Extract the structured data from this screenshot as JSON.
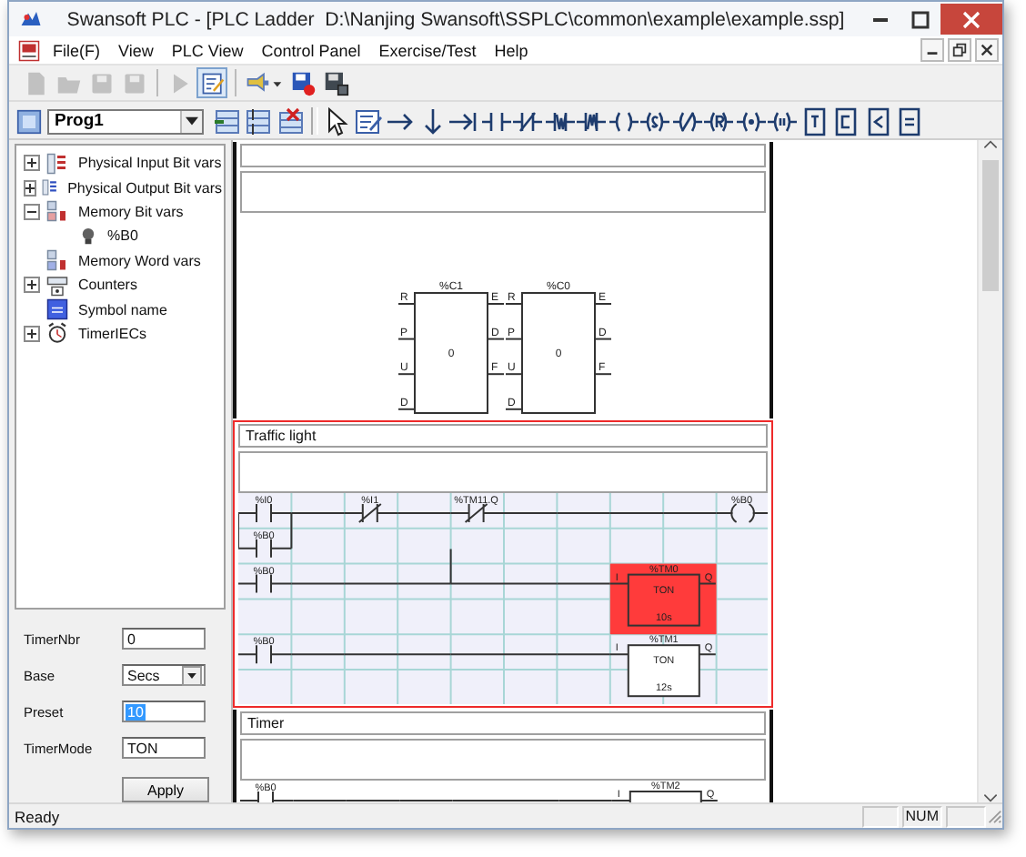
{
  "window": {
    "title": "Swansoft PLC - [PLC Ladder  D:\\Nanjing Swansoft\\SSPLC\\common\\example\\example.ssp]"
  },
  "menu": [
    "File(F)",
    "View",
    "PLC View",
    "Control Panel",
    "Exercise/Test",
    "Help"
  ],
  "toolbar": [
    {
      "kind": "page",
      "disabled": true,
      "selected": false
    },
    {
      "kind": "folder",
      "disabled": true,
      "selected": false
    },
    {
      "kind": "disk",
      "disabled": true,
      "selected": false
    },
    {
      "kind": "disk",
      "disabled": true,
      "selected": false
    },
    {
      "kind": "separator"
    },
    {
      "kind": "play",
      "disabled": true,
      "selected": false
    },
    {
      "kind": "edit",
      "disabled": false,
      "selected": true
    },
    {
      "kind": "separator"
    },
    {
      "kind": "connect",
      "disabled": false,
      "selected": false
    },
    {
      "kind": "disk_red",
      "disabled": false,
      "selected": false
    },
    {
      "kind": "disk_dark",
      "disabled": false,
      "selected": false
    }
  ],
  "program": {
    "value": "Prog1"
  },
  "tools": [
    {
      "kind": "rows_add"
    },
    {
      "kind": "rows_insert"
    },
    {
      "kind": "rows_delete"
    },
    {
      "kind": "separator"
    },
    {
      "kind": "pointer"
    },
    {
      "kind": "properties"
    },
    {
      "kind": "wire_h"
    },
    {
      "kind": "wire_v"
    },
    {
      "kind": "wire_end"
    },
    {
      "kind": "contact_no"
    },
    {
      "kind": "contact_nc"
    },
    {
      "kind": "contact_p"
    },
    {
      "kind": "contact_n"
    },
    {
      "kind": "coil"
    },
    {
      "kind": "coil_s"
    },
    {
      "kind": "coil_slash"
    },
    {
      "kind": "coil_r"
    },
    {
      "kind": "coil_dot"
    },
    {
      "kind": "coil_open"
    },
    {
      "kind": "box_t"
    },
    {
      "kind": "box_c"
    },
    {
      "kind": "box_lt"
    },
    {
      "kind": "box_eq"
    }
  ],
  "tree": [
    {
      "label": "Physical Input Bit vars",
      "kind": "input_bits",
      "expanded": false
    },
    {
      "label": "Physical Output Bit vars",
      "kind": "output_bits",
      "expanded": false
    },
    {
      "label": "Memory Bit vars",
      "kind": "memory_bits",
      "expanded": true,
      "children": [
        {
          "label": "%B0",
          "kind": "bulb"
        }
      ]
    },
    {
      "label": "Memory Word vars",
      "kind": "memory_words"
    },
    {
      "label": "Counters",
      "kind": "counters",
      "expanded": false
    },
    {
      "label": "Symbol name",
      "kind": "symbols"
    },
    {
      "label": "TimerIECs",
      "kind": "timers",
      "expanded": false
    }
  ],
  "form": {
    "fields": [
      {
        "label": "TimerNbr",
        "kind": "text",
        "value": "0",
        "selected": false
      },
      {
        "label": "Base",
        "kind": "select",
        "value": "Secs",
        "selected": false
      },
      {
        "label": "Preset",
        "kind": "text",
        "value": "10",
        "selected": true
      },
      {
        "label": "TimerMode",
        "kind": "text",
        "value": "TON",
        "selected": false
      }
    ],
    "button": "Apply"
  },
  "ladder": [
    {
      "kind": "counters",
      "selected": false,
      "blocks": [
        {
          "name": "%C1",
          "value": "0",
          "left_pins": [
            "R",
            "P",
            "U",
            "D"
          ],
          "right_pins": [
            "E",
            "D",
            "F"
          ]
        },
        {
          "name": "%C0",
          "value": "0",
          "left_pins": [
            "R",
            "P",
            "U",
            "D"
          ],
          "right_pins": [
            "E",
            "D",
            "F"
          ]
        }
      ]
    },
    {
      "kind": "rungs",
      "title": "Traffic light",
      "selected": true,
      "rows": [
        {
          "cells": [
            {
              "kind": "contact",
              "label": "%I0"
            },
            {
              "kind": "wire"
            },
            {
              "kind": "nc_contact",
              "label": "%I1"
            },
            {
              "kind": "wire"
            },
            {
              "kind": "nc_contact",
              "label": "%TM11.Q"
            },
            {
              "kind": "wire"
            },
            {
              "kind": "wire"
            },
            {
              "kind": "wire"
            },
            {
              "kind": "wire"
            },
            {
              "kind": "coil",
              "label": "%B0"
            }
          ]
        },
        {
          "cells": [
            {
              "kind": "parallel_contact",
              "label": "%B0"
            },
            {
              "kind": "empty"
            },
            {
              "kind": "empty"
            },
            {
              "kind": "empty"
            },
            {
              "kind": "empty"
            },
            {
              "kind": "empty"
            },
            {
              "kind": "empty"
            },
            {
              "kind": "empty"
            },
            {
              "kind": "empty"
            },
            {
              "kind": "empty"
            }
          ]
        },
        {
          "cells": [
            {
              "kind": "contact",
              "label": "%B0"
            },
            {
              "kind": "wire"
            },
            {
              "kind": "wire"
            },
            {
              "kind": "wire"
            },
            {
              "kind": "wire_stub"
            },
            {
              "kind": "wire"
            },
            {
              "kind": "wire"
            },
            {
              "kind": "block",
              "name": "%TM0",
              "input": "I",
              "output": "Q",
              "type": "TON",
              "preset": "10s",
              "selected": true
            },
            {
              "kind": "empty"
            },
            {
              "kind": "empty"
            }
          ]
        },
        {
          "cells": [
            {
              "kind": "empty"
            },
            {
              "kind": "empty"
            },
            {
              "kind": "empty"
            },
            {
              "kind": "empty"
            },
            {
              "kind": "empty"
            },
            {
              "kind": "empty"
            },
            {
              "kind": "empty"
            },
            {
              "kind": "empty"
            },
            {
              "kind": "empty"
            },
            {
              "kind": "empty"
            }
          ]
        },
        {
          "cells": [
            {
              "kind": "contact",
              "label": "%B0"
            },
            {
              "kind": "wire"
            },
            {
              "kind": "wire"
            },
            {
              "kind": "wire"
            },
            {
              "kind": "wire"
            },
            {
              "kind": "wire"
            },
            {
              "kind": "wire"
            },
            {
              "kind": "block",
              "name": "%TM1",
              "input": "I",
              "output": "Q",
              "type": "TON",
              "preset": "12s",
              "selected": false
            },
            {
              "kind": "empty"
            },
            {
              "kind": "empty"
            }
          ]
        },
        {
          "cells": [
            {
              "kind": "empty"
            },
            {
              "kind": "empty"
            },
            {
              "kind": "empty"
            },
            {
              "kind": "empty"
            },
            {
              "kind": "empty"
            },
            {
              "kind": "empty"
            },
            {
              "kind": "empty"
            },
            {
              "kind": "empty"
            },
            {
              "kind": "empty"
            },
            {
              "kind": "empty"
            }
          ]
        }
      ]
    },
    {
      "kind": "rungs",
      "title": "Timer",
      "selected": false,
      "rows": [
        {
          "cells": [
            {
              "kind": "contact",
              "label": "%B0"
            },
            {
              "kind": "wire"
            },
            {
              "kind": "wire"
            },
            {
              "kind": "wire"
            },
            {
              "kind": "wire"
            },
            {
              "kind": "wire"
            },
            {
              "kind": "wire"
            },
            {
              "kind": "block",
              "name": "%TM2",
              "input": "I",
              "output": "Q",
              "selected": false
            },
            {
              "kind": "empty"
            },
            {
              "kind": "empty"
            }
          ]
        }
      ]
    }
  ],
  "status_bar": {
    "text": "Ready",
    "panels": [
      "NUM"
    ]
  }
}
